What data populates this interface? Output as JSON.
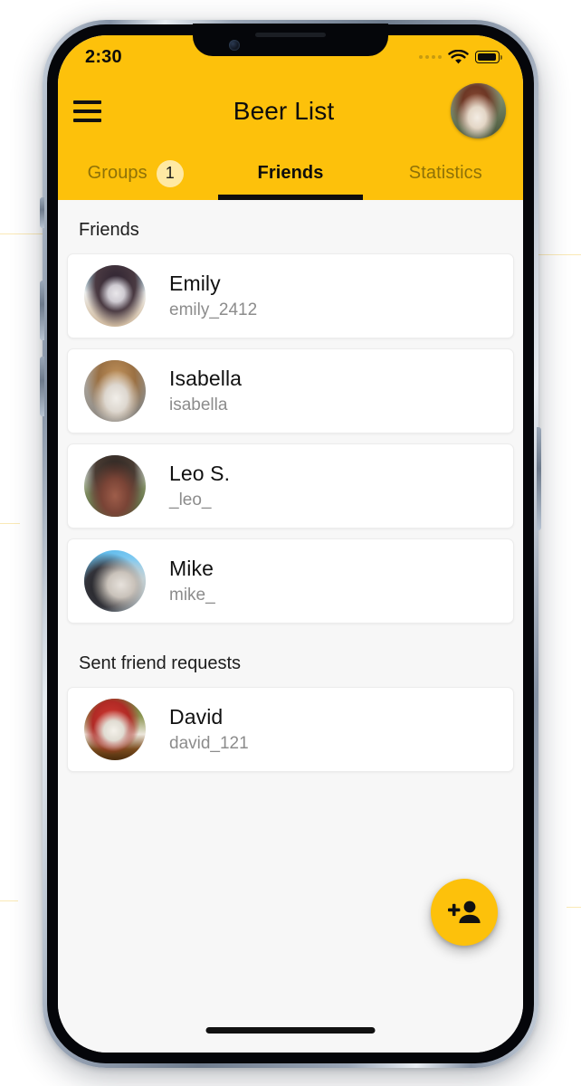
{
  "status_bar": {
    "time": "2:30",
    "signal_icon": "signal-dots-icon",
    "wifi_icon": "wifi-icon",
    "battery_icon": "battery-full-icon"
  },
  "app_bar": {
    "menu_icon": "hamburger-menu-icon",
    "title": "Beer List",
    "avatar_icon": "profile-avatar"
  },
  "tabs": [
    {
      "label": "Groups",
      "badge": "1",
      "active": false
    },
    {
      "label": "Friends",
      "badge": "",
      "active": true
    },
    {
      "label": "Statistics",
      "badge": "",
      "active": false
    }
  ],
  "sections": [
    {
      "header": "Friends",
      "items": [
        {
          "name": "Emily",
          "handle": "emily_2412"
        },
        {
          "name": "Isabella",
          "handle": "isabella"
        },
        {
          "name": "Leo S.",
          "handle": "_leo_"
        },
        {
          "name": "Mike",
          "handle": "mike_"
        }
      ]
    },
    {
      "header": "Sent friend requests",
      "items": [
        {
          "name": "David",
          "handle": "david_121"
        }
      ]
    }
  ],
  "fab": {
    "icon": "person-add-icon",
    "label": "Add friend"
  },
  "colors": {
    "accent": "#FDC10B",
    "badge": "#FFE9A3",
    "page_bg": "#F7F7F7",
    "card_bg": "#FFFFFF",
    "primary_text": "#111111",
    "secondary_text": "#8C8C8C",
    "inactive_tab_text": "#8E7108"
  }
}
